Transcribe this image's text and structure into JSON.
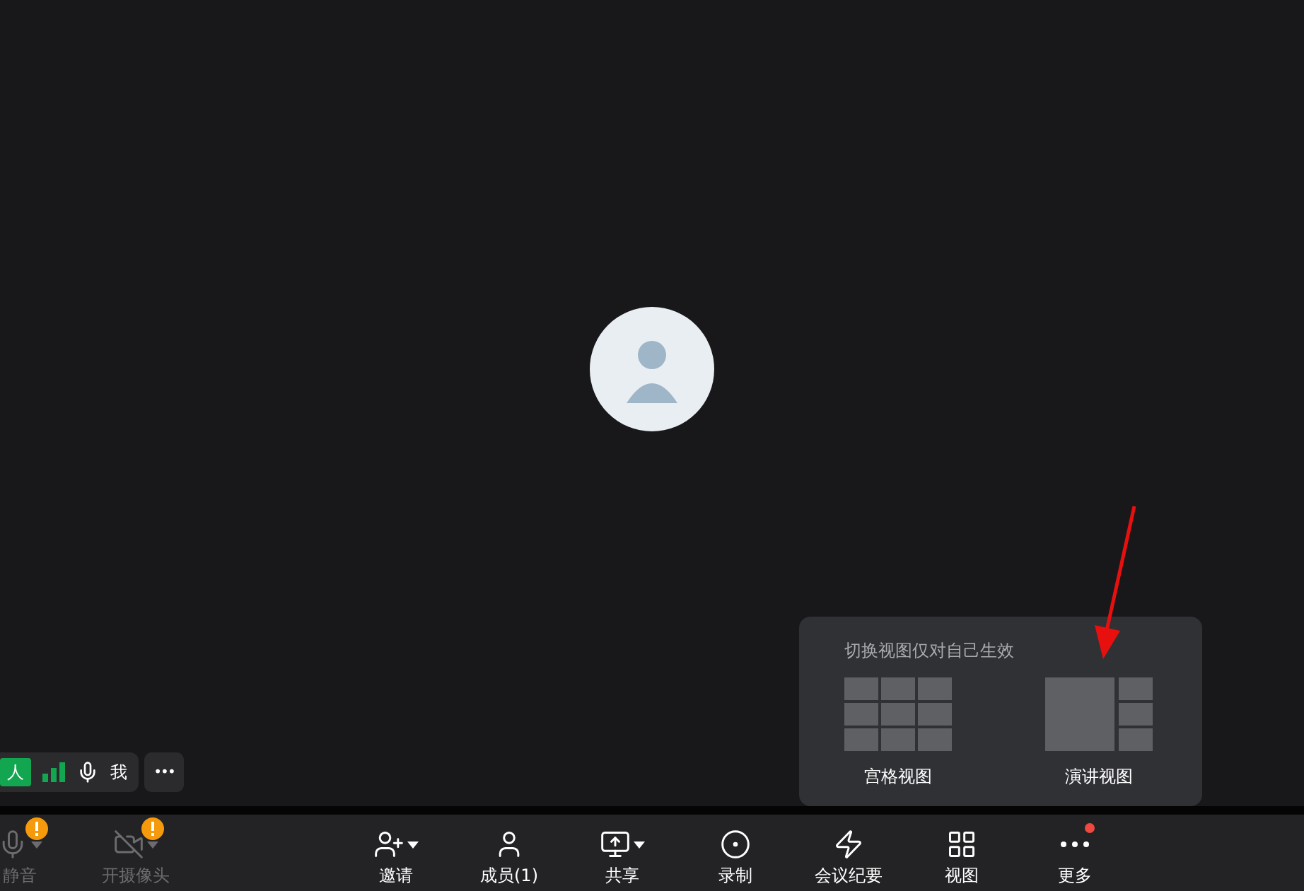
{
  "participant_bar": {
    "role_tag": "人",
    "name": "我",
    "more": "•••"
  },
  "view_popup": {
    "title": "切换视图仅对自己生效",
    "options": [
      {
        "kind": "grid",
        "label": "宫格视图"
      },
      {
        "kind": "speaker",
        "label": "演讲视图"
      }
    ]
  },
  "toolbar": {
    "items": [
      {
        "kind": "mic",
        "label": "静音",
        "disabled": true,
        "warning": true,
        "has_menu": true,
        "notice": false
      },
      {
        "kind": "camera",
        "label": "开摄像头",
        "disabled": true,
        "warning": true,
        "has_menu": true,
        "notice": false
      },
      {
        "kind": "invite",
        "label": "邀请",
        "disabled": false,
        "warning": false,
        "has_menu": true,
        "notice": false
      },
      {
        "kind": "members",
        "label": "成员(1)",
        "disabled": false,
        "warning": false,
        "has_menu": false,
        "notice": false
      },
      {
        "kind": "share",
        "label": "共享",
        "disabled": false,
        "warning": false,
        "has_menu": true,
        "notice": false
      },
      {
        "kind": "record",
        "label": "录制",
        "disabled": false,
        "warning": false,
        "has_menu": false,
        "notice": false
      },
      {
        "kind": "summary",
        "label": "会议纪要",
        "disabled": false,
        "warning": false,
        "has_menu": false,
        "notice": false
      },
      {
        "kind": "view",
        "label": "视图",
        "disabled": false,
        "warning": false,
        "has_menu": false,
        "notice": false
      },
      {
        "kind": "more",
        "label": "更多",
        "disabled": false,
        "warning": false,
        "has_menu": false,
        "notice": true
      }
    ]
  }
}
